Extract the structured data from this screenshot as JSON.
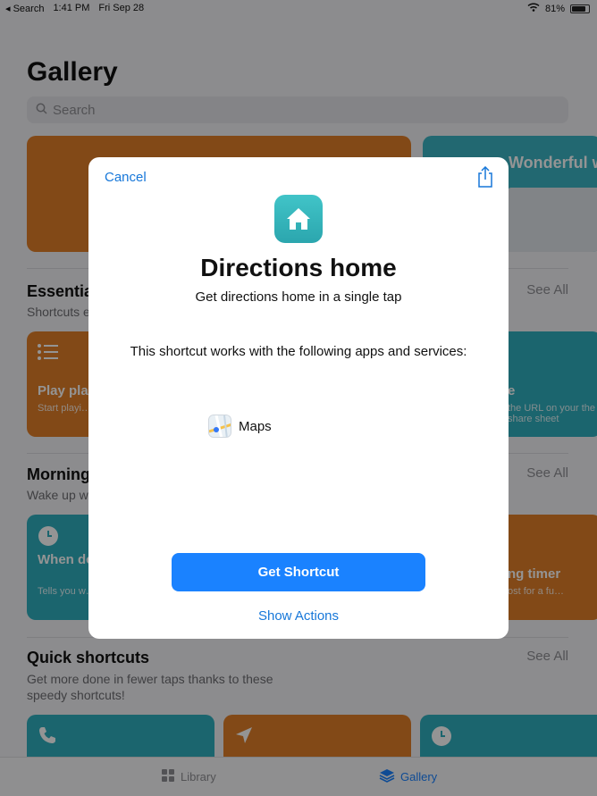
{
  "status_bar": {
    "back_app": "◂ Search",
    "time": "1:41 PM",
    "date": "Fri Sep 28",
    "battery_percent": "81%",
    "battery_level": 0.81
  },
  "gallery": {
    "title": "Gallery",
    "search_placeholder": "Search",
    "banner_text": "Wonderful w",
    "sections": [
      {
        "title": "Essentia",
        "subtitle": "Shortcuts e",
        "see_all": "See All",
        "cards": [
          {
            "title": "Play play",
            "subtitle": "Start playi… playlist ne…"
          },
          {
            "title": "e",
            "subtitle": "the URL on your the share sheet"
          }
        ]
      },
      {
        "title": "Morning",
        "subtitle": "Wake up w",
        "see_all": "See All",
        "cards": [
          {
            "title": "When do… leave by",
            "subtitle": "Tells you w… you're not"
          },
          {
            "title": "ng timer",
            "subtitle": "ost for a fu…"
          }
        ]
      },
      {
        "title": "Quick shortcuts",
        "subtitle": "Get more done in fewer taps thanks to these speedy shortcuts!",
        "see_all": "See All"
      }
    ],
    "tabs": {
      "library": "Library",
      "gallery": "Gallery"
    }
  },
  "modal": {
    "cancel": "Cancel",
    "title": "Directions home",
    "subtitle": "Get directions home in a single tap",
    "works_with": "This shortcut works with the following apps and services:",
    "services": [
      "Maps"
    ],
    "get_button": "Get Shortcut",
    "show_actions": "Show Actions"
  },
  "colors": {
    "accent": "#1a82ff",
    "link": "#1677d9",
    "orange_card": "#e07e28",
    "teal_card": "#2faebd"
  }
}
